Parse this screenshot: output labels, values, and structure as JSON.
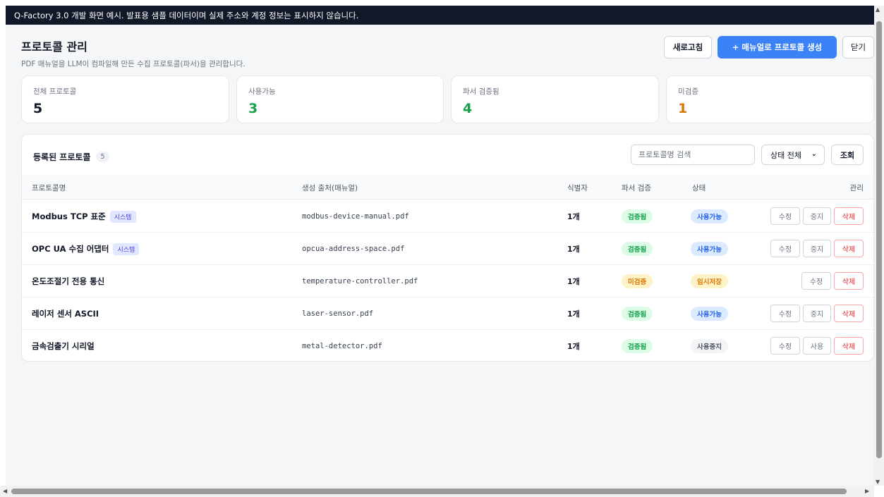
{
  "banner": "Q-Factory 3.0 개발 화면 예시. 발표용 샘플 데이터이며 실제 주소와 계정 정보는 표시하지 않습니다.",
  "header": {
    "title": "프로토콜 관리",
    "subtitle": "PDF 매뉴얼을 LLM이 컴파일해 만든 수집 프로토콜(파서)을 관리합니다."
  },
  "actions": {
    "refresh": "새로고침",
    "create": "+ 매뉴얼로 프로토콜 생성",
    "close": "닫기"
  },
  "stats": [
    {
      "label": "전체 프로토콜",
      "value": "5",
      "color": "#111827"
    },
    {
      "label": "사용가능",
      "value": "3",
      "color": "#16a34a"
    },
    {
      "label": "파서 검증됨",
      "value": "4",
      "color": "#16a34a"
    },
    {
      "label": "미검증",
      "value": "1",
      "color": "#d97706"
    }
  ],
  "panel": {
    "title": "등록된 프로토콜",
    "count": "5",
    "search_placeholder": "프로토콜명 검색",
    "status_filter": "상태 전체",
    "query": "조회"
  },
  "columns": {
    "name": "프로토콜명",
    "source": "생성 출처(매뉴얼)",
    "ident": "식별자",
    "verify": "파서 검증",
    "status": "상태",
    "manage": "관리"
  },
  "rows": [
    {
      "name": "Modbus TCP 표준",
      "badge": "시스템",
      "source": "modbus-device-manual.pdf",
      "ident": "1개",
      "verify": "검증됨",
      "status": "사용가능",
      "edit": "수정",
      "toggle": "중지",
      "delete": "삭제"
    },
    {
      "name": "OPC UA 수집 어댑터",
      "badge": "시스템",
      "source": "opcua-address-space.pdf",
      "ident": "1개",
      "verify": "검증됨",
      "status": "사용가능",
      "edit": "수정",
      "toggle": "중지",
      "delete": "삭제"
    },
    {
      "name": "온도조절기 전용 통신",
      "badge": "",
      "source": "temperature-controller.pdf",
      "ident": "1개",
      "verify": "미검증",
      "status": "임시저장",
      "edit": "수정",
      "toggle": "",
      "delete": "삭제"
    },
    {
      "name": "레이저 센서 ASCII",
      "badge": "",
      "source": "laser-sensor.pdf",
      "ident": "1개",
      "verify": "검증됨",
      "status": "사용가능",
      "edit": "수정",
      "toggle": "중지",
      "delete": "삭제"
    },
    {
      "name": "금속검출기 시리얼",
      "badge": "",
      "source": "metal-detector.pdf",
      "ident": "1개",
      "verify": "검증됨",
      "status": "사용중지",
      "edit": "수정",
      "toggle": "사용",
      "delete": "삭제"
    }
  ],
  "colors": {
    "primary": "#3b82f6",
    "verified_bg": "#dcfce7",
    "verified_fg": "#16a34a",
    "unverified_bg": "#fef3c7",
    "unverified_fg": "#d97706",
    "active_bg": "#dbeafe",
    "active_fg": "#2563eb",
    "draft_bg": "#fef3c7",
    "draft_fg": "#d97706",
    "stopped_bg": "#f3f4f6",
    "stopped_fg": "#4b5563"
  }
}
